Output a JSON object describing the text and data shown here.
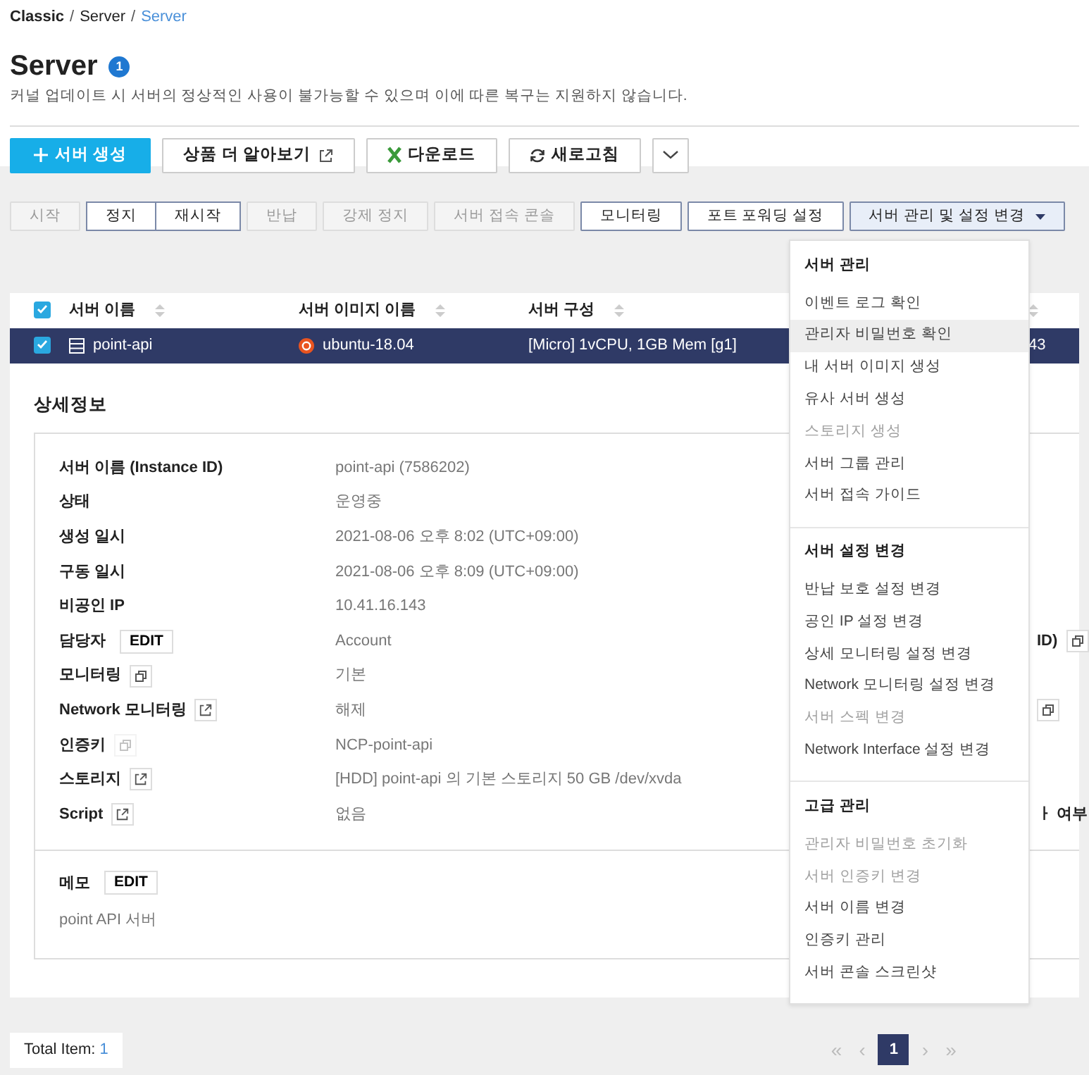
{
  "breadcrumb": [
    {
      "label": "Classic",
      "kind": "root",
      "separator": "/"
    },
    {
      "label": "Server",
      "kind": "crumb",
      "separator": "/"
    },
    {
      "label": "Server",
      "kind": "current"
    }
  ],
  "title": "Server",
  "title_badge": "1",
  "description": "커널 업데이트 시 서버의 정상적인 사용이 불가능할 수 있으며 이에 따른 복구는 지원하지 않습니다.",
  "top_buttons": [
    {
      "label": "서버 생성",
      "kind": "create"
    },
    {
      "label": "상품 더 알아보기",
      "kind": "external"
    },
    {
      "label": "다운로드",
      "kind": "excel"
    },
    {
      "label": "새로고침",
      "kind": "refresh"
    },
    {
      "kind": "more"
    }
  ],
  "actions": [
    {
      "label": "시작",
      "disabled": true,
      "grouped": false
    },
    {
      "label": "정지",
      "disabled": false,
      "grouped": true
    },
    {
      "label": "재시작",
      "disabled": false,
      "grouped": true
    },
    {
      "label": "반납",
      "disabled": true,
      "grouped": false
    },
    {
      "label": "강제 정지",
      "disabled": true,
      "grouped": false
    },
    {
      "label": "서버 접속 콘솔",
      "disabled": true,
      "grouped": false
    },
    {
      "label": "모니터링",
      "disabled": false,
      "grouped": false
    },
    {
      "label": "포트 포워딩 설정",
      "disabled": false,
      "grouped": false
    },
    {
      "label": "서버 관리 및 설정 변경",
      "disabled": false,
      "grouped": false,
      "dropdown": true,
      "expanded": true
    }
  ],
  "table": {
    "all_checked": true,
    "columns": [
      {
        "label": "서버 이름"
      },
      {
        "label": "서버 이미지 이름"
      },
      {
        "label": "서버 구성"
      },
      {}
    ],
    "rows": [
      {
        "checked": true,
        "selected": true,
        "name": "point-api",
        "image": "ubuntu-18.04",
        "config": "[Micro] 1vCPU, 1GB Mem [g1]",
        "column_4": "43"
      }
    ]
  },
  "details": {
    "title": "상세정보",
    "rows": [
      {
        "label": "서버 이름 (Instance ID)",
        "value": "point-api (7586202)"
      },
      {
        "label": "상태",
        "value": "운영중"
      },
      {
        "label": "생성 일시",
        "value": "2021-08-06 오후 8:02 (UTC+09:00)"
      },
      {
        "label": "구동 일시",
        "value": "2021-08-06 오후 8:09 (UTC+09:00)"
      },
      {
        "label": "비공인 IP",
        "value": "10.41.16.143"
      },
      {
        "label": "담당자",
        "value": "Account",
        "action": {
          "kind": "edit",
          "label": "EDIT",
          "disabled": false
        },
        "right": {
          "text": "ID)",
          "copy": true
        }
      },
      {
        "label": "모니터링",
        "value": "기본",
        "action": {
          "kind": "copy",
          "disabled": false
        }
      },
      {
        "label": "Network 모니터링",
        "value": "해제",
        "action": {
          "kind": "external",
          "disabled": false
        },
        "right": {
          "copy": true
        }
      },
      {
        "label": "인증키",
        "value": "NCP-point-api",
        "action": {
          "kind": "copy",
          "disabled": true
        }
      },
      {
        "label": "스토리지",
        "value": "[HDD] point-api 의 기본 스토리지  50 GB /dev/xvda",
        "action": {
          "kind": "external",
          "disabled": false
        }
      },
      {
        "label": "Script",
        "value": "없음",
        "action": {
          "kind": "external",
          "disabled": false
        },
        "right": {
          "text": "ㅏ 여부"
        }
      }
    ],
    "memo": {
      "label": "메모",
      "action": "EDIT",
      "text": "point API 서버"
    }
  },
  "menu": [
    {
      "header": "서버 관리",
      "items": [
        {
          "label": "이벤트 로그 확인",
          "disabled": false,
          "selected": false
        },
        {
          "label": "관리자 비밀번호 확인",
          "disabled": false,
          "selected": true
        },
        {
          "label": "내 서버 이미지 생성",
          "disabled": false,
          "selected": false
        },
        {
          "label": "유사 서버 생성",
          "disabled": false,
          "selected": false
        },
        {
          "label": "스토리지 생성",
          "disabled": true,
          "selected": false
        },
        {
          "label": "서버 그룹 관리",
          "disabled": false,
          "selected": false
        },
        {
          "label": "서버 접속 가이드",
          "disabled": false,
          "selected": false
        }
      ]
    },
    {
      "header": "서버 설정 변경",
      "items": [
        {
          "label": "반납 보호 설정 변경",
          "disabled": false,
          "selected": false
        },
        {
          "label": "공인 IP 설정 변경",
          "disabled": false,
          "selected": false
        },
        {
          "label": "상세 모니터링 설정 변경",
          "disabled": false,
          "selected": false
        },
        {
          "label": "Network 모니터링 설정 변경",
          "disabled": false,
          "selected": false
        },
        {
          "label": "서버 스펙 변경",
          "disabled": true,
          "selected": false
        },
        {
          "label": "Network Interface 설정 변경",
          "disabled": false,
          "selected": false
        }
      ]
    },
    {
      "header": "고급 관리",
      "items": [
        {
          "label": "관리자 비밀번호 초기화",
          "disabled": true,
          "selected": false
        },
        {
          "label": "서버 인증키 변경",
          "disabled": true,
          "selected": false
        },
        {
          "label": "서버 이름 변경",
          "disabled": false,
          "selected": false
        },
        {
          "label": "인증키 관리",
          "disabled": false,
          "selected": false
        },
        {
          "label": "서버 콘솔 스크린샷",
          "disabled": false,
          "selected": false
        }
      ]
    }
  ],
  "footer": {
    "total_label": "Total Item:",
    "total_value": "1",
    "pages": [
      {
        "label": "«",
        "disabled": true,
        "selected": false
      },
      {
        "label": "‹",
        "disabled": true,
        "selected": false
      },
      {
        "label": "1",
        "disabled": false,
        "selected": true
      },
      {
        "label": "›",
        "disabled": true,
        "selected": false
      },
      {
        "label": "»",
        "disabled": true,
        "selected": false
      }
    ]
  }
}
